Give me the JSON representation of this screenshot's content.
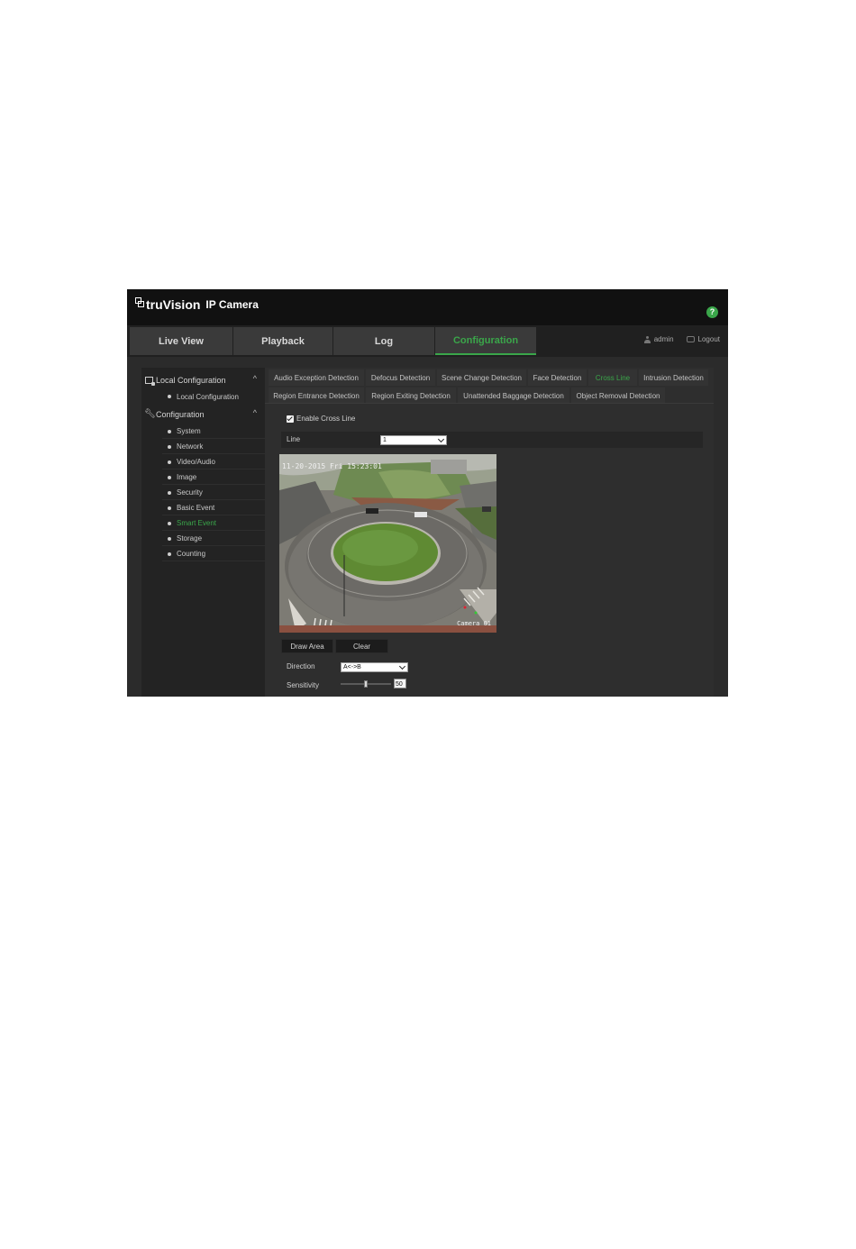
{
  "app": {
    "logo_brand": "truVision",
    "logo_product": "IP Camera"
  },
  "nav": {
    "tabs": [
      {
        "label": "Live View"
      },
      {
        "label": "Playback"
      },
      {
        "label": "Log"
      },
      {
        "label": "Configuration",
        "active": true
      }
    ],
    "user": "admin",
    "logout": "Logout"
  },
  "sidebar": {
    "local_header": "Local Configuration",
    "local_items": [
      {
        "label": "Local Configuration"
      }
    ],
    "config_header": "Configuration",
    "config_items": [
      {
        "label": "System"
      },
      {
        "label": "Network"
      },
      {
        "label": "Video/Audio"
      },
      {
        "label": "Image"
      },
      {
        "label": "Security"
      },
      {
        "label": "Basic Event"
      },
      {
        "label": "Smart Event",
        "active": true
      },
      {
        "label": "Storage"
      },
      {
        "label": "Counting"
      }
    ]
  },
  "subtabs": {
    "row1": [
      {
        "label": "Audio Exception Detection"
      },
      {
        "label": "Defocus Detection"
      },
      {
        "label": "Scene Change Detection"
      },
      {
        "label": "Face Detection"
      },
      {
        "label": "Cross Line",
        "active": true
      },
      {
        "label": "Intrusion Detection"
      }
    ],
    "row2": [
      {
        "label": "Region Entrance Detection"
      },
      {
        "label": "Region Exiting Detection"
      },
      {
        "label": "Unattended Baggage Detection"
      },
      {
        "label": "Object Removal Detection"
      }
    ]
  },
  "form": {
    "enable_label": "Enable Cross Line",
    "enable_checked": true,
    "line_label": "Line",
    "line_value": "1",
    "video_timestamp": "11-20-2015 Fri 15:23:01",
    "video_camera_name": "Camera 01",
    "draw_button": "Draw Area",
    "clear_button": "Clear",
    "direction_label": "Direction",
    "direction_value": "A<->B",
    "sensitivity_label": "Sensitivity",
    "sensitivity_value": "50"
  },
  "colors": {
    "accent": "#3aa64a",
    "help_icon": "#3aa64a"
  },
  "icons": {
    "help": "question-mark-icon",
    "user": "user-icon",
    "logout": "logout-icon",
    "local_config": "monitor-icon",
    "configuration": "wrench-icon"
  }
}
